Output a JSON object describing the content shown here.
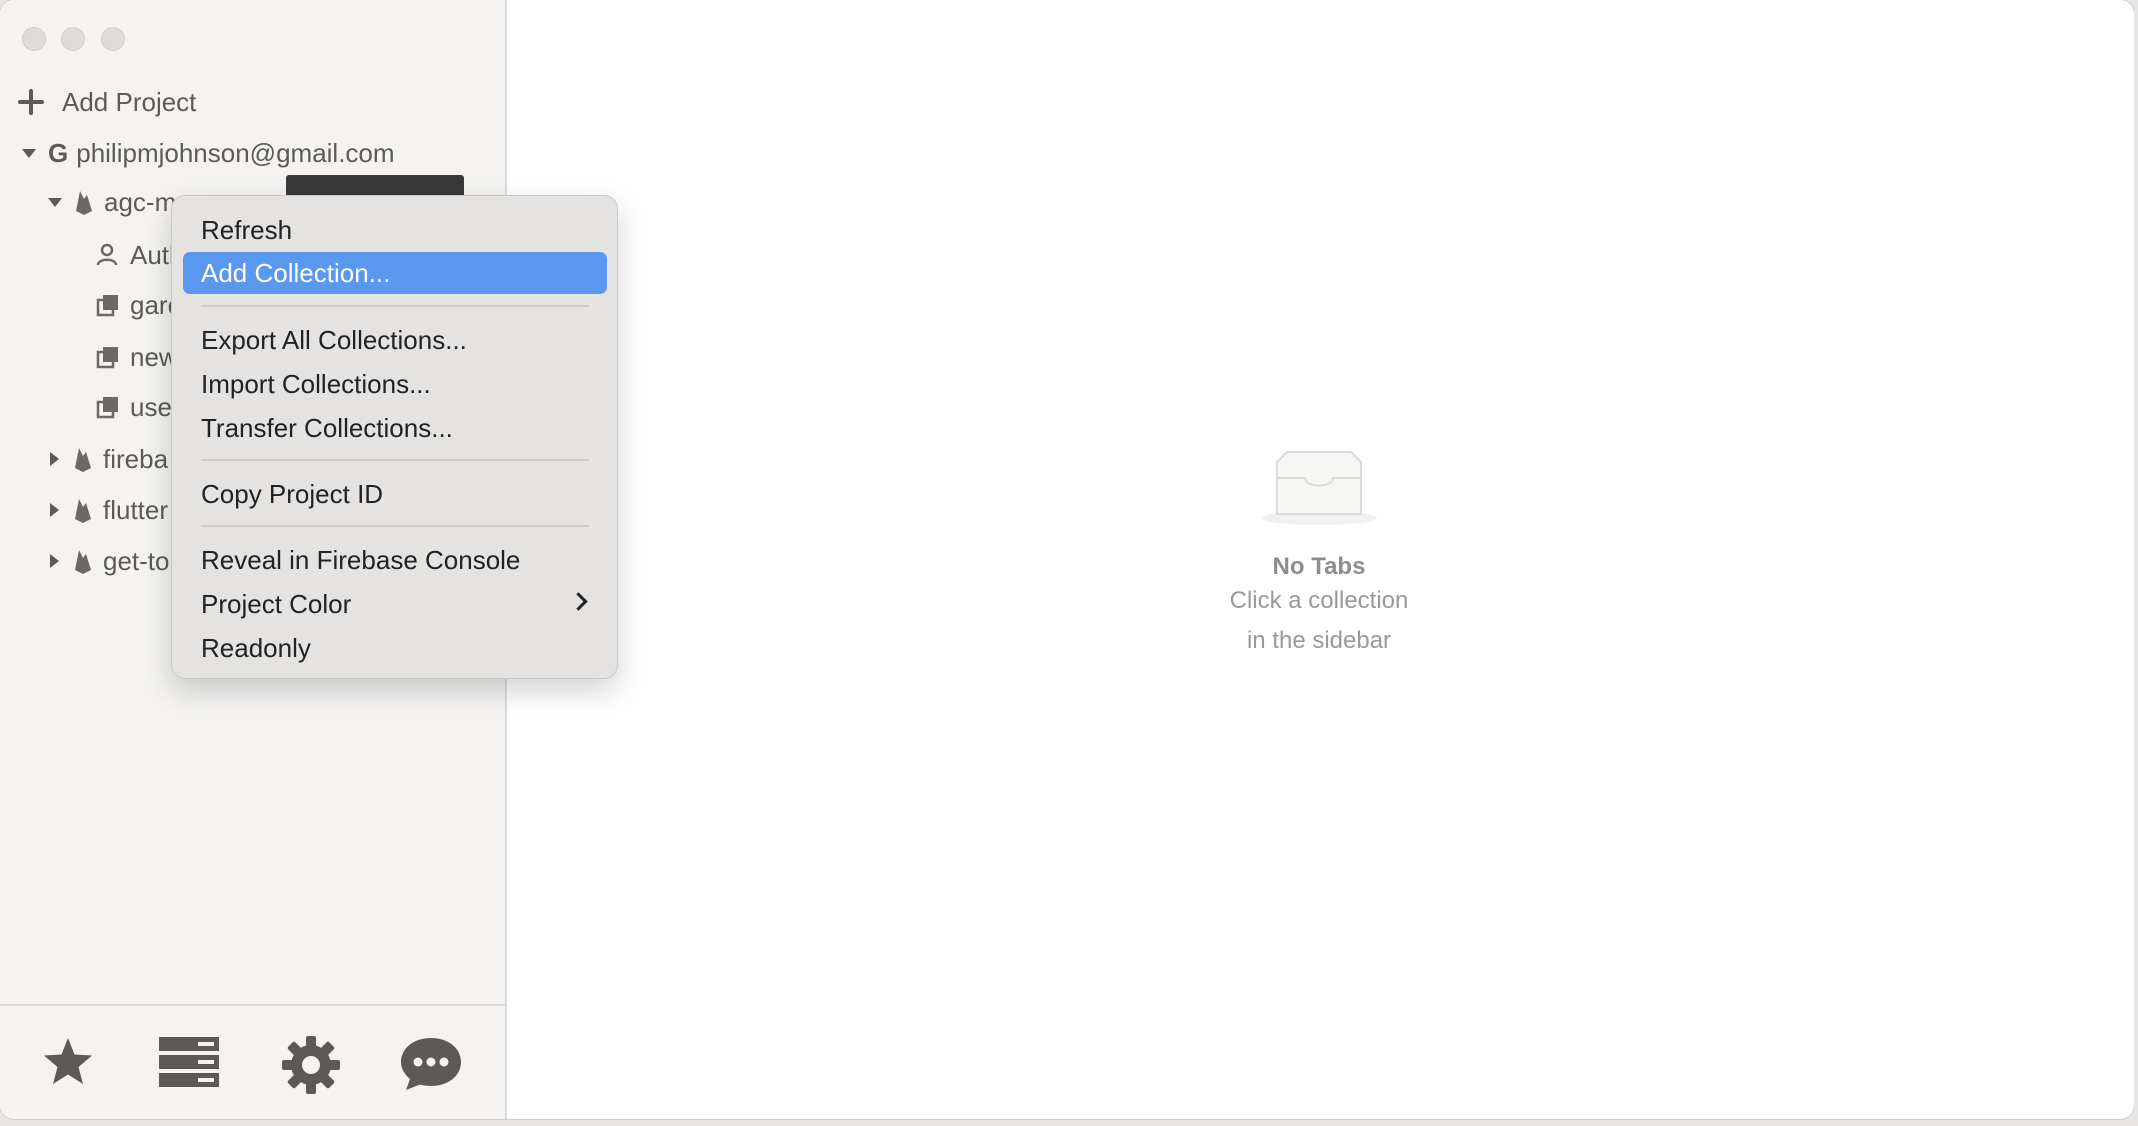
{
  "sidebar": {
    "add_project_label": "Add Project",
    "account": {
      "label": "philipmjohnson@gmail.com",
      "icon": "G"
    },
    "project": {
      "label": "agc-m"
    },
    "children": [
      {
        "label": "Autl",
        "icon": "auth-icon"
      },
      {
        "label": "garc",
        "icon": "collection-icon"
      },
      {
        "label": "new",
        "icon": "collection-icon"
      },
      {
        "label": "use",
        "icon": "collection-icon"
      }
    ],
    "other_projects": [
      {
        "label": "fireba"
      },
      {
        "label": "flutter"
      },
      {
        "label": "get-to"
      }
    ],
    "bottom_icons": [
      "star-icon",
      "server-icon",
      "gear-icon",
      "chat-icon"
    ]
  },
  "context_menu": {
    "items": [
      {
        "label": "Refresh"
      },
      {
        "label": "Add Collection..."
      },
      {
        "label": "Export All Collections..."
      },
      {
        "label": "Import Collections..."
      },
      {
        "label": "Transfer Collections..."
      },
      {
        "label": "Copy Project ID"
      },
      {
        "label": "Reveal in Firebase Console"
      },
      {
        "label": "Project Color"
      },
      {
        "label": "Readonly"
      }
    ]
  },
  "main": {
    "empty_title": "No Tabs",
    "empty_line1": "Click a collection",
    "empty_line2": "in the sidebar"
  },
  "colors": {
    "highlight": "#5a98f0",
    "sidebar_bg": "#f4f3f1",
    "icon_gray": "#5b5a58"
  }
}
